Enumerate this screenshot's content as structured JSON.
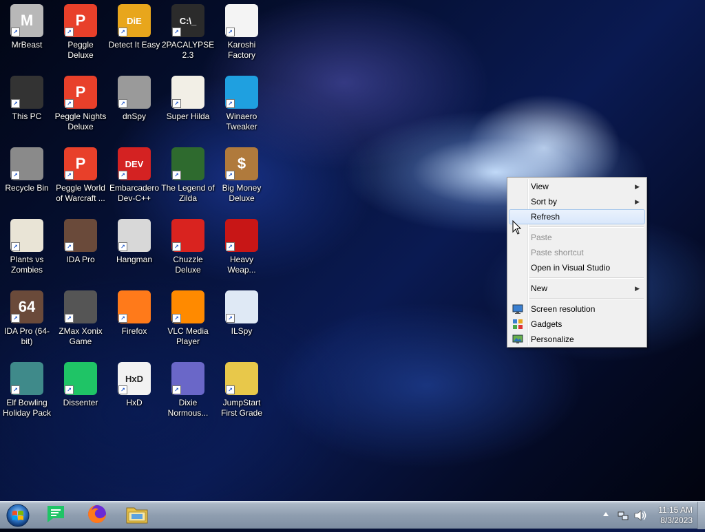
{
  "desktop": {
    "icons": [
      {
        "label": "MrBeast",
        "icon": "mrbeast-icon",
        "color": "#b8b8b8",
        "glyph": "M"
      },
      {
        "label": "Peggle Deluxe",
        "icon": "peggle-icon",
        "color": "#e8402a",
        "glyph": "P"
      },
      {
        "label": "Detect It Easy",
        "icon": "die-icon",
        "color": "#e8a61c",
        "glyph": "DiE"
      },
      {
        "label": "2PACALYPSE 2.3",
        "icon": "console-icon",
        "color": "#2b2b2b",
        "glyph": "C:\\_"
      },
      {
        "label": "Karoshi Factory",
        "icon": "file-icon",
        "color": "#f4f4f4",
        "glyph": ""
      },
      {
        "label": "This PC",
        "icon": "computer-icon",
        "color": "#333333",
        "glyph": ""
      },
      {
        "label": "Peggle Nights Deluxe",
        "icon": "peggle-nights-icon",
        "color": "#e8402a",
        "glyph": "P"
      },
      {
        "label": "dnSpy",
        "icon": "dnspy-icon",
        "color": "#9a9a9a",
        "glyph": ""
      },
      {
        "label": "Super Hilda",
        "icon": "hilda-icon",
        "color": "#f2efe6",
        "glyph": ""
      },
      {
        "label": "Winaero Tweaker",
        "icon": "winaero-icon",
        "color": "#1fa0e0",
        "glyph": ""
      },
      {
        "label": "Recycle Bin",
        "icon": "recycle-bin-icon",
        "color": "#8a8a8a",
        "glyph": ""
      },
      {
        "label": "Peggle World of Warcraft ...",
        "icon": "peggle-wow-icon",
        "color": "#e8402a",
        "glyph": "P"
      },
      {
        "label": "Embarcadero Dev-C++",
        "icon": "devcpp-icon",
        "color": "#d42222",
        "glyph": "DEV"
      },
      {
        "label": "The Legend of Zilda",
        "icon": "zilda-icon",
        "color": "#2e6a2e",
        "glyph": ""
      },
      {
        "label": "Big Money Deluxe",
        "icon": "money-bag-icon",
        "color": "#b07a3c",
        "glyph": "$"
      },
      {
        "label": "Plants vs Zombies",
        "icon": "pvz-icon",
        "color": "#e9e4d6",
        "glyph": ""
      },
      {
        "label": "IDA Pro",
        "icon": "ida-icon",
        "color": "#6a4a3a",
        "glyph": ""
      },
      {
        "label": "Hangman",
        "icon": "hangman-icon",
        "color": "#d8d8d8",
        "glyph": ""
      },
      {
        "label": "Chuzzle Deluxe",
        "icon": "chuzzle-icon",
        "color": "#d9231f",
        "glyph": ""
      },
      {
        "label": "Heavy Weap...",
        "icon": "radiation-icon",
        "color": "#c81616",
        "glyph": ""
      },
      {
        "label": "IDA Pro (64-bit)",
        "icon": "ida64-icon",
        "color": "#6a4a3a",
        "glyph": "64"
      },
      {
        "label": "ZMax Xonix Game",
        "icon": "xonix-icon",
        "color": "#555555",
        "glyph": ""
      },
      {
        "label": "Firefox",
        "icon": "firefox-icon",
        "color": "#ff7a1a",
        "glyph": ""
      },
      {
        "label": "VLC Media Player",
        "icon": "vlc-icon",
        "color": "#ff8a00",
        "glyph": ""
      },
      {
        "label": "ILSpy",
        "icon": "ilspy-icon",
        "color": "#dfe9f5",
        "glyph": ""
      },
      {
        "label": "Elf Bowling Holiday Pack",
        "icon": "elf-bowling-icon",
        "color": "#3f8a8a",
        "glyph": ""
      },
      {
        "label": "Dissenter",
        "icon": "dissenter-icon",
        "color": "#1fc466",
        "glyph": ""
      },
      {
        "label": "HxD",
        "icon": "hxd-icon",
        "color": "#f2f2f2",
        "glyph": "HxD"
      },
      {
        "label": "Dixie Normous...",
        "icon": "dixie-icon",
        "color": "#6a67c8",
        "glyph": ""
      },
      {
        "label": "JumpStart First Grade",
        "icon": "jumpstart-icon",
        "color": "#e8c84a",
        "glyph": ""
      }
    ]
  },
  "context_menu": {
    "items": [
      {
        "label": "View",
        "submenu": true,
        "disabled": false,
        "icon": ""
      },
      {
        "label": "Sort by",
        "submenu": true,
        "disabled": false,
        "icon": ""
      },
      {
        "label": "Refresh",
        "submenu": false,
        "disabled": false,
        "icon": "",
        "highlighted": true
      },
      {
        "label": "Paste",
        "submenu": false,
        "disabled": true,
        "icon": ""
      },
      {
        "label": "Paste shortcut",
        "submenu": false,
        "disabled": true,
        "icon": ""
      },
      {
        "label": "Open in Visual Studio",
        "submenu": false,
        "disabled": false,
        "icon": ""
      },
      {
        "label": "New",
        "submenu": true,
        "disabled": false,
        "icon": ""
      },
      {
        "label": "Screen resolution",
        "submenu": false,
        "disabled": false,
        "icon": "monitor-icon"
      },
      {
        "label": "Gadgets",
        "submenu": false,
        "disabled": false,
        "icon": "gadgets-icon"
      },
      {
        "label": "Personalize",
        "submenu": false,
        "disabled": false,
        "icon": "personalize-icon"
      }
    ]
  },
  "taskbar": {
    "pinned": [
      {
        "name": "dissenter-taskbar-icon",
        "color": "#1fc466"
      },
      {
        "name": "firefox-taskbar-icon",
        "color": "#ff7a1a"
      },
      {
        "name": "file-explorer-taskbar-icon",
        "color": "#e8c24a"
      }
    ],
    "clock": {
      "time": "11:15 AM",
      "date": "8/3/2023"
    }
  }
}
